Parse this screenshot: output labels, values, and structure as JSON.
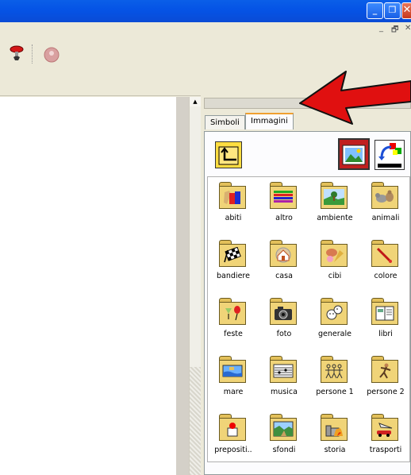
{
  "window": {
    "controls": {
      "minimize": "_",
      "maximize": "❐",
      "close": "✕"
    },
    "mdi_controls": {
      "minimize": "_",
      "restore": "🗗",
      "close": "✕"
    }
  },
  "tabs": [
    {
      "label": "Simboli",
      "active": false
    },
    {
      "label": "Immagini",
      "active": true
    }
  ],
  "folders": [
    {
      "label": "abiti",
      "pic": "clothes"
    },
    {
      "label": "altro",
      "pic": "stripes"
    },
    {
      "label": "ambiente",
      "pic": "landscape"
    },
    {
      "label": "animali",
      "pic": "animals"
    },
    {
      "label": "bandiere",
      "pic": "checkered-flag"
    },
    {
      "label": "casa",
      "pic": "house"
    },
    {
      "label": "cibi",
      "pic": "food"
    },
    {
      "label": "colore",
      "pic": "paint"
    },
    {
      "label": "feste",
      "pic": "party"
    },
    {
      "label": "foto",
      "pic": "camera"
    },
    {
      "label": "generale",
      "pic": "faces"
    },
    {
      "label": "libri",
      "pic": "book"
    },
    {
      "label": "mare",
      "pic": "sea"
    },
    {
      "label": "musica",
      "pic": "notes"
    },
    {
      "label": "persone 1",
      "pic": "people"
    },
    {
      "label": "persone 2",
      "pic": "runner"
    },
    {
      "label": "prepositi..",
      "pic": "preposition"
    },
    {
      "label": "sfondi",
      "pic": "backgrounds"
    },
    {
      "label": "storia",
      "pic": "castle"
    },
    {
      "label": "trasporti",
      "pic": "vehicles"
    }
  ],
  "colors": {
    "titlebar": "#0a5fe8",
    "arrow": "#e01010",
    "active_tab_accent": "#f0a030"
  },
  "icons": [
    "paint-brush-icon",
    "record-icon",
    "folder-up-icon",
    "image-view-icon",
    "swap-colors-icon"
  ]
}
